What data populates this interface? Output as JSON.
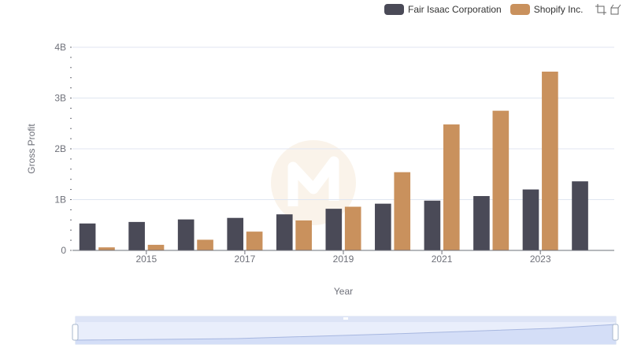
{
  "chart_data": {
    "type": "bar",
    "title": "",
    "xlabel": "Year",
    "ylabel": "Gross Profit",
    "categories": [
      "2014",
      "2015",
      "2016",
      "2017",
      "2018",
      "2019",
      "2020",
      "2021",
      "2022",
      "2023",
      "2024"
    ],
    "x_tick_labels": [
      "2015",
      "2017",
      "2019",
      "2021",
      "2023"
    ],
    "y_ticks": [
      0,
      1000000000,
      2000000000,
      3000000000,
      4000000000
    ],
    "y_tick_labels": [
      "0",
      "1B",
      "2B",
      "3B",
      "4B"
    ],
    "ylim": [
      0,
      4000000000
    ],
    "grid": true,
    "legend_position": "top-right",
    "series": [
      {
        "name": "Fair Isaac Corporation",
        "color": "#4a4a57",
        "values": [
          530000000,
          560000000,
          610000000,
          640000000,
          710000000,
          820000000,
          920000000,
          980000000,
          1070000000,
          1200000000,
          1360000000
        ]
      },
      {
        "name": "Shopify Inc.",
        "color": "#c9915d",
        "values": [
          60000000,
          110000000,
          210000000,
          370000000,
          590000000,
          860000000,
          1540000000,
          2480000000,
          2750000000,
          3520000000,
          null
        ]
      }
    ]
  },
  "toolbox": {
    "zoom_icon": "data-zoom-icon",
    "reset_icon": "zoom-reset-icon"
  },
  "watermark": {
    "icon": "brand-logo-watermark"
  }
}
